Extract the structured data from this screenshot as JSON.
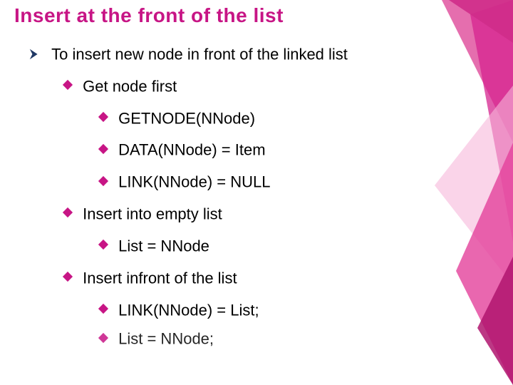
{
  "title": "Insert at the front of the list",
  "arrow_color": "#1F3864",
  "accent_color": "#C71585",
  "lines": [
    {
      "level": 1,
      "text": "To insert new node in front of the linked list"
    },
    {
      "level": 2,
      "text": "Get node first"
    },
    {
      "level": 3,
      "text": "GETNODE(NNode)"
    },
    {
      "level": 3,
      "text": "DATA(NNode) = Item"
    },
    {
      "level": 3,
      "text": "LINK(NNode) = NULL"
    },
    {
      "level": 2,
      "text": "Insert into empty list"
    },
    {
      "level": 3,
      "text": "List = NNode"
    },
    {
      "level": 2,
      "text": "Insert infront of the list"
    },
    {
      "level": 3,
      "text": "LINK(NNode) = List;"
    },
    {
      "level": 3,
      "text": "List = NNode;"
    }
  ]
}
